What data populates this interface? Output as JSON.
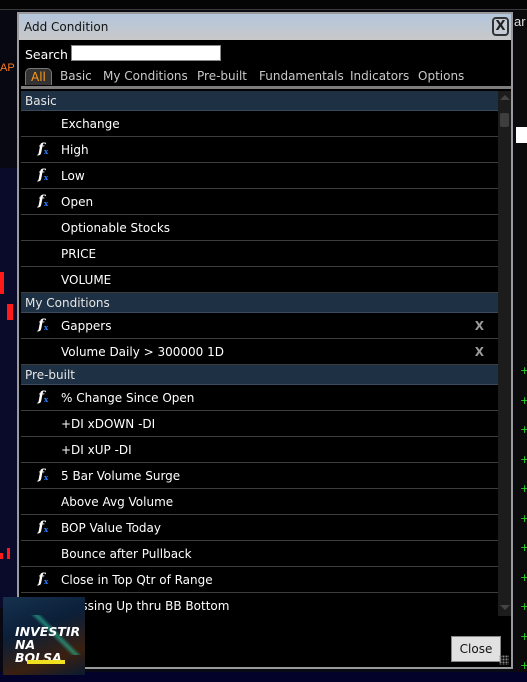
{
  "background": {
    "left_label": "AP",
    "right_label": "ar"
  },
  "dialog": {
    "title": "Add Condition",
    "close_icon_glyph": "X",
    "search": {
      "label": "Search",
      "value": "",
      "placeholder": ""
    },
    "tabs": [
      {
        "label": "All",
        "active": true
      },
      {
        "label": "Basic",
        "active": false
      },
      {
        "label": "My Conditions",
        "active": false
      },
      {
        "label": "Pre-built",
        "active": false
      },
      {
        "label": "Fundamentals",
        "active": false
      },
      {
        "label": "Indicators",
        "active": false
      },
      {
        "label": "Options",
        "active": false
      }
    ],
    "sections": [
      {
        "title": "Basic",
        "items": [
          {
            "label": "Exchange",
            "formula": false
          },
          {
            "label": "High",
            "formula": true
          },
          {
            "label": "Low",
            "formula": true
          },
          {
            "label": "Open",
            "formula": true
          },
          {
            "label": "Optionable Stocks",
            "formula": false
          },
          {
            "label": "PRICE",
            "formula": false
          },
          {
            "label": "VOLUME",
            "formula": false
          }
        ]
      },
      {
        "title": "My Conditions",
        "items": [
          {
            "label": "Gappers",
            "formula": true,
            "deletable": true
          },
          {
            "label": "Volume  Daily > 300000 1D",
            "formula": false,
            "deletable": true
          }
        ]
      },
      {
        "title": "Pre-built",
        "items": [
          {
            "label": "% Change Since Open",
            "formula": true
          },
          {
            "label": "+DI xDOWN -DI",
            "formula": false
          },
          {
            "label": "+DI xUP -DI",
            "formula": false
          },
          {
            "label": "5 Bar Volume Surge",
            "formula": true
          },
          {
            "label": "Above Avg Volume",
            "formula": false
          },
          {
            "label": "BOP Value Today",
            "formula": true
          },
          {
            "label": "Bounce after Pullback",
            "formula": false
          },
          {
            "label": "Close in Top Qtr of Range",
            "formula": true
          },
          {
            "label": "Crossing Up thru BB Bottom",
            "formula": false
          }
        ]
      }
    ],
    "formula_icon": {
      "main": "f",
      "sub": "x"
    },
    "delete_glyph": "X",
    "close_button": "Close"
  },
  "logo": {
    "line1": "INVESTIR",
    "line2": "NA BOLSA"
  },
  "colors": {
    "active_tab": "#ff9a1a",
    "section_bg": "#1e3044",
    "formula_accent": "#2a7dff"
  }
}
